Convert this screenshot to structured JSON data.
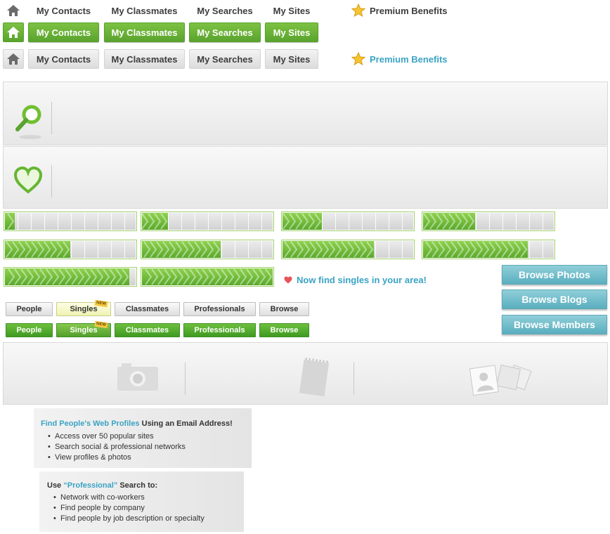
{
  "nav": {
    "tabs": [
      "My Contacts",
      "My Classmates",
      "My Searches",
      "My Sites"
    ],
    "premium_label": "Premium Benefits",
    "home_icon": "home-icon",
    "star_icon": "star-icon"
  },
  "panels": {
    "search_icon": "magnifier-icon",
    "heart_icon": "heart-icon"
  },
  "progress": {
    "bars": [
      0.05,
      0.2,
      0.3,
      0.4,
      0.5,
      0.6,
      0.7,
      0.8,
      0.95,
      1.0
    ]
  },
  "promo": {
    "text": "Now find singles in your area!"
  },
  "browse": {
    "photos": "Browse Photos",
    "blogs": "Browse Blogs",
    "members": "Browse Members"
  },
  "categories": {
    "items": [
      "People",
      "Singles",
      "Classmates",
      "Professionals",
      "Browse"
    ],
    "new_badge": "NEW"
  },
  "info_email": {
    "link": "Find People's Web Profiles",
    "rest": " Using an Email Address!",
    "bullets": [
      "Access over 50 popular sites",
      "Search social & professional networks",
      "View profiles & photos"
    ]
  },
  "info_professional": {
    "prefix": "Use ",
    "quoted": "“Professional”",
    "suffix": " Search to:",
    "bullets": [
      "Network with co-workers",
      "Find people by company",
      "Find people by job description or specialty"
    ]
  },
  "colors": {
    "green": "#5aa32d",
    "teal": "#5aaebf",
    "link_blue": "#3aa3c4"
  }
}
